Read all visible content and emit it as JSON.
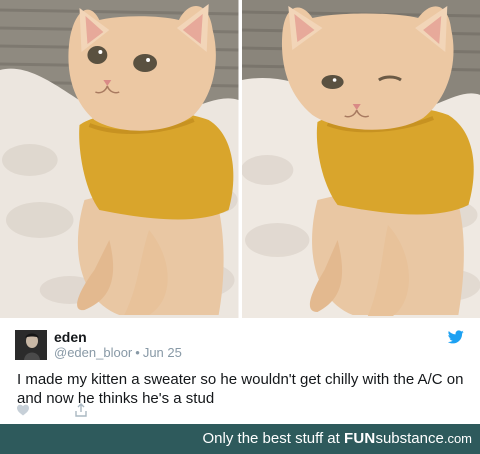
{
  "photos": [
    {
      "subject": "orange-kitten-in-yellow-sweater",
      "expression": "eyes-open"
    },
    {
      "subject": "orange-kitten-in-yellow-sweater",
      "expression": "winking"
    }
  ],
  "tweet": {
    "display_name": "eden",
    "handle": "@eden_bloor",
    "separator": "•",
    "date": "Jun 25",
    "text": "I made my kitten a sweater so he wouldn't get chilly with the A/C on and now he thinks he's a stud",
    "icons": {
      "platform": "twitter-bird-icon",
      "like": "heart-icon",
      "share": "share-icon"
    },
    "colors": {
      "bird": "#1da1f2",
      "muted": "#8899a6",
      "text": "#14171a"
    }
  },
  "footer": {
    "tagline": "Only the best stuff at",
    "brand_fun": "FUN",
    "brand_sub": "substance",
    "brand_dom": ".com",
    "background": "#2e5a5c"
  }
}
